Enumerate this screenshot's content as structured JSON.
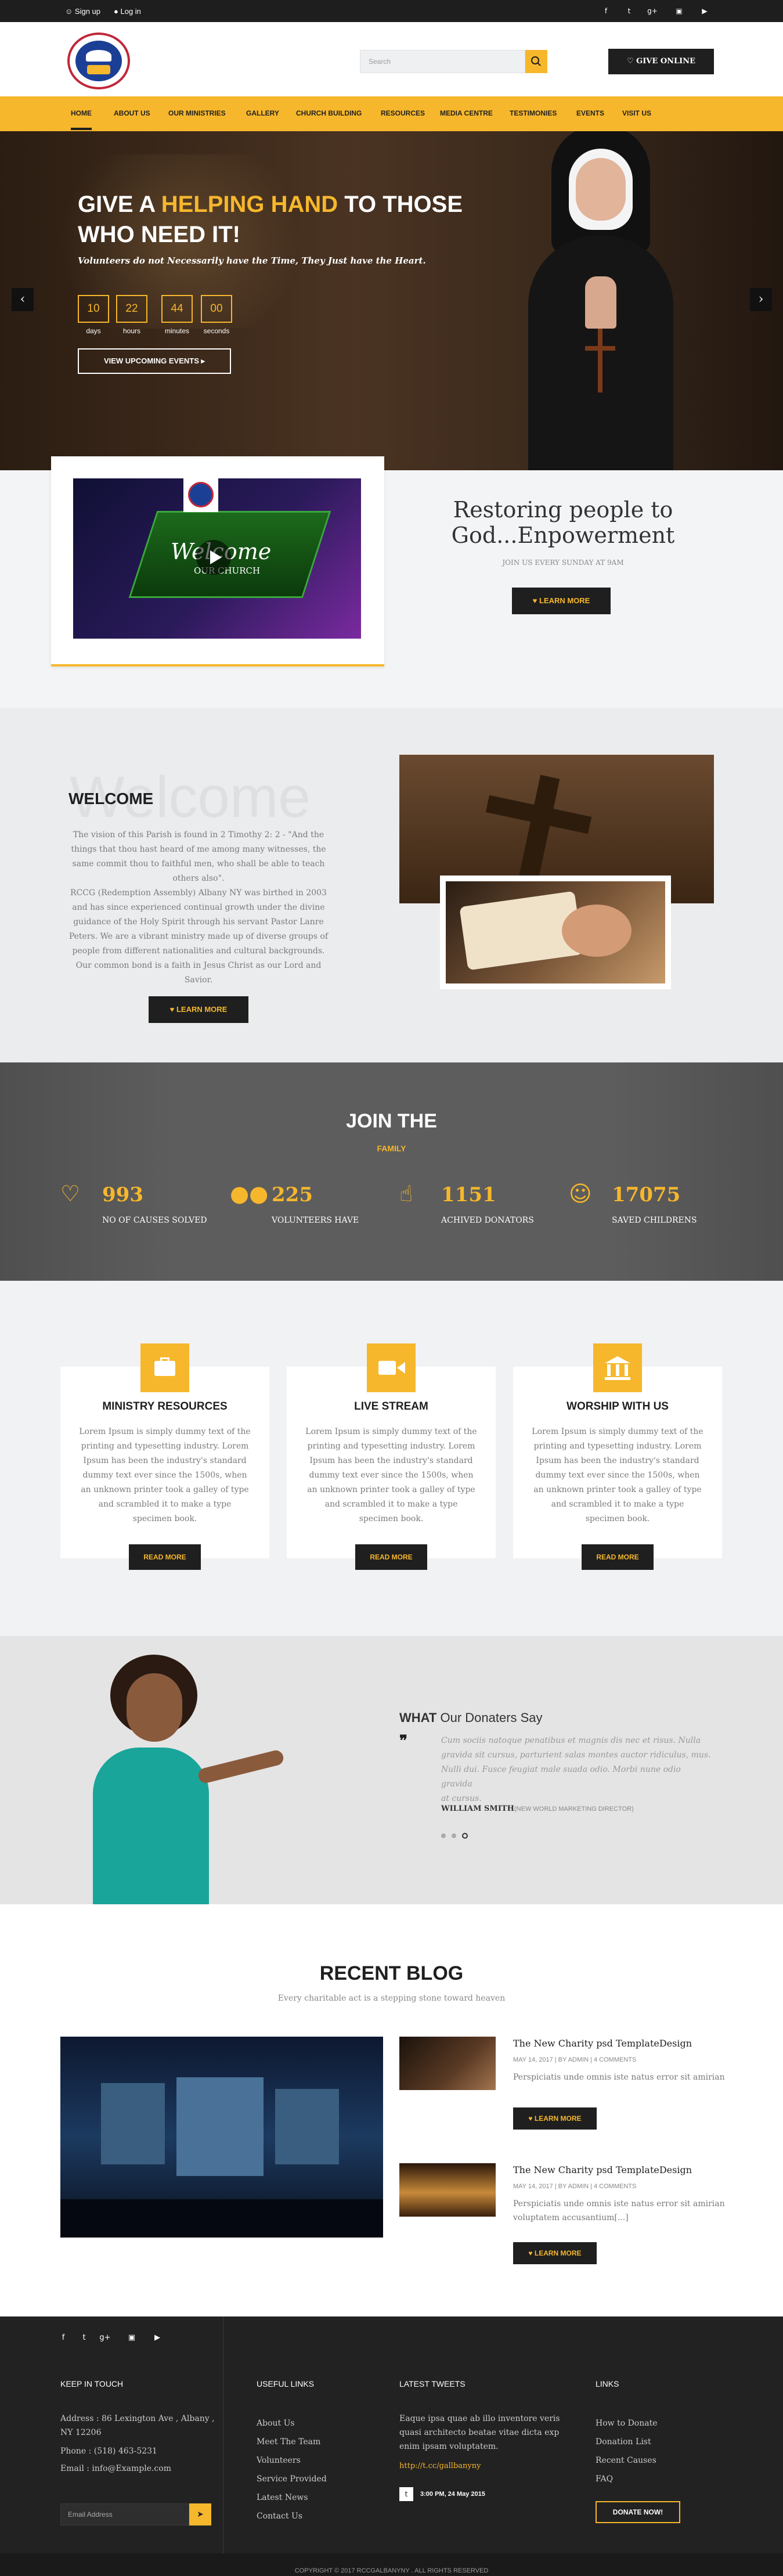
{
  "topbar": {
    "signup": "Sign up",
    "login": "Log in",
    "social_icons": [
      "facebook-icon",
      "twitter-icon",
      "google-plus-icon",
      "instagram-icon",
      "youtube-icon"
    ]
  },
  "header": {
    "search_placeholder": "Search",
    "give_online": "GIVE ONLINE"
  },
  "nav": [
    "HOME",
    "ABOUT US",
    "OUR MINISTRIES",
    "GALLERY",
    "CHURCH BUILDING",
    "RESOURCES",
    "MEDIA CENTRE",
    "TESTIMONIES",
    "EVENTS",
    "VISIT US"
  ],
  "hero": {
    "title_pre": "GIVE A ",
    "title_highlight": "HELPING HAND",
    "title_post": " TO THOSE",
    "title_line2": "WHO NEED IT!",
    "subtitle": "Volunteers do not Necessarily have the Time, They Just have the Heart.",
    "countdown": [
      {
        "value": "10",
        "label": "days"
      },
      {
        "value": "22",
        "label": "hours"
      },
      {
        "value": "44",
        "label": "minutes"
      },
      {
        "value": "00",
        "label": "seconds"
      }
    ],
    "cta": "VIEW UPCOMING EVENTS",
    "prev_arrow": "‹",
    "next_arrow": "›"
  },
  "video_section": {
    "video_text_line1": "Welcome",
    "video_text_line2": "OUR CHURCH",
    "heading_line1": "Restoring people to",
    "heading_line2": "God...Enpowerment",
    "sub": "JOIN US EVERY SUNDAY AT 9AM",
    "button": "LEARN MORE"
  },
  "welcome": {
    "ghost": "Welcome",
    "title": "WELCOME",
    "para1": "The vision of this Parish is found in 2 Timothy 2: 2 - \"And the things that thou hast heard of me among many witnesses, the same commit thou to faithful men, who shall be able to teach others also\".",
    "para2": "RCCG (Redemption Assembly) Albany NY was birthed in 2003 and has since experienced continual growth under the divine guidance of the Holy Spirit through his servant Pastor Lanre Peters. We are a vibrant ministry made up of diverse groups of people from different nationalities and cultural backgrounds. Our common bond is a faith in Jesus Christ as our Lord and Savior.",
    "button": "LEARN MORE"
  },
  "join": {
    "title": "JOIN THE",
    "subtitle": "FAMILY",
    "stats": [
      {
        "icon": "heart-icon",
        "value": "993",
        "label": "NO OF CAUSES SOLVED"
      },
      {
        "icon": "users-icon",
        "value": "225",
        "label": "VOLUNTEERS HAVE"
      },
      {
        "icon": "thumbs-up-icon",
        "value": "1151",
        "label": "ACHIVED DONATORS"
      },
      {
        "icon": "smile-icon",
        "value": "17075",
        "label": "SAVED CHILDRENS"
      }
    ]
  },
  "services": [
    {
      "icon": "briefcase-icon",
      "title": "MINISTRY RESOURCES",
      "text": "Lorem Ipsum is simply dummy text of the printing and typesetting industry. Lorem Ipsum has been the industry's standard dummy text ever since the 1500s, when an unknown printer took a galley of type and scrambled it to make a type specimen book.",
      "button": "READ MORE"
    },
    {
      "icon": "video-camera-icon",
      "title": "LIVE STREAM",
      "text": "Lorem Ipsum is simply dummy text of the printing and typesetting industry. Lorem Ipsum has been the industry's standard dummy text ever since the 1500s, when an unknown printer took a galley of type and scrambled it to make a type specimen book.",
      "button": "READ MORE"
    },
    {
      "icon": "bank-icon",
      "title": "WORSHIP WITH US",
      "text": "Lorem Ipsum is simply dummy text of the printing and typesetting industry. Lorem Ipsum has been the industry's standard dummy text ever since the 1500s, when an unknown printer took a galley of type and scrambled it to make a type specimen book.",
      "button": "READ MORE"
    }
  ],
  "testimonial": {
    "heading_bold": "WHAT",
    "heading_rest": " Our Donaters Say",
    "quote_line1": "Cum sociis natoque penatibus et magnis dis nec et risus. Nulla",
    "quote_line2": "gravida sit cursus, parturient salas montes auctor ridiculus, mus.",
    "quote_line3": "Nulli dui. Fusce feugiat male suada odio. Morbi nune odio gravida",
    "quote_line4": "at cursus.",
    "author": "WILLIAM SMITH",
    "role": "(NEW WORLD MARKETING DIRECTOR)"
  },
  "blog": {
    "title": "RECENT BLOG",
    "subtitle": "Every charitable act is a stepping stone toward heaven",
    "posts": [
      {
        "title": "The New Charity psd TemplateDesign",
        "meta": "MAY 14, 2017 | BY ADMIN | 4 COMMENTS",
        "excerpt_line1": "Perspiciatis unde omnis iste natus error sit amirian",
        "excerpt_line2": "",
        "button": "LEARN MORE"
      },
      {
        "title": "The New Charity psd TemplateDesign",
        "meta": "MAY 14, 2017 | BY ADMIN | 4 COMMENTS",
        "excerpt_line1": "Perspiciatis unde omnis iste natus error sit amirian",
        "excerpt_line2": "voluptatem accusantium[...]",
        "button": "LEARN MORE"
      }
    ]
  },
  "footer": {
    "keep_in_touch": "KEEP IN TOUCH",
    "address_line1": "Address : 86 Lexington Ave , Albany ,",
    "address_line2": "NY 12206",
    "phone": "Phone : (518) 463-5231",
    "email": "Email : info@Example.com",
    "email_placeholder": "Email Address",
    "useful_links_title": "USEFUL LINKS",
    "useful_links": [
      "About Us",
      "Meet The Team",
      "Volunteers",
      "Service Provided",
      "Latest News",
      "Contact Us"
    ],
    "tweets_title": "LATEST TWEETS",
    "tweet_line1": "Eaque ipsa quae ab illo inventore veris",
    "tweet_line2": "quasi architecto beatae vitae dicta exp",
    "tweet_line3": "enim ipsam voluptatem.",
    "tweet_handle": "http://t.cc/gallbanyny",
    "tweet_time": "3:00 PM, 24 May 2015",
    "links_title": "LINKS",
    "links": [
      "How to Donate",
      "Donation List",
      "Recent Causes",
      "FAQ"
    ],
    "donate_button": "DONATE NOW!",
    "copyright": "COPYRIGHT © 2017 RCCGALBANYNY . ALL RIGHTS RESERVED"
  },
  "colors": {
    "accent": "#f6b72c",
    "dark": "#1f1f1f",
    "footer": "#222222"
  }
}
